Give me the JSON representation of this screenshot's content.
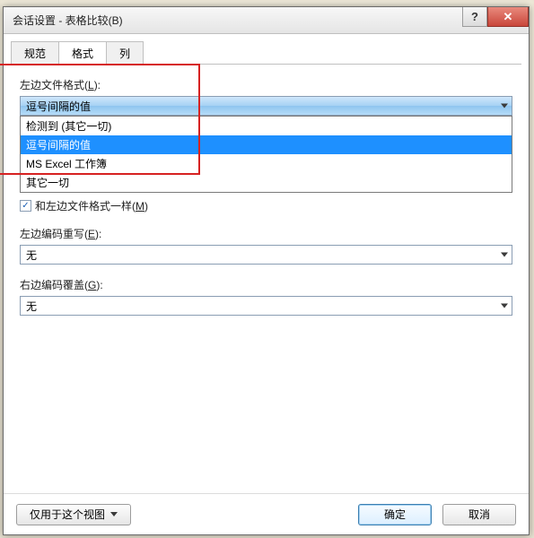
{
  "window": {
    "title": "会话设置 - 表格比较(B)",
    "help_glyph": "?",
    "close_glyph": "✕"
  },
  "tabs": [
    {
      "label": "规范",
      "active": false
    },
    {
      "label": "格式",
      "active": true
    },
    {
      "label": "列",
      "active": false
    }
  ],
  "left_format": {
    "label_prefix": "左边文件格式(",
    "label_mnemonic": "L",
    "label_suffix": "):",
    "combo_value": "逗号间隔的值",
    "options": [
      {
        "label": "检测到 (其它一切)",
        "selected": false
      },
      {
        "label": "逗号间隔的值",
        "selected": true
      },
      {
        "label": "MS Excel 工作簿",
        "selected": false
      },
      {
        "label": "其它一切",
        "selected": false
      }
    ]
  },
  "same_as_left": {
    "checked": true,
    "label_prefix": "和左边文件格式一样(",
    "label_mnemonic": "M",
    "label_suffix": ")"
  },
  "left_encoding_override": {
    "label_prefix": "左边编码重写(",
    "label_mnemonic": "E",
    "label_suffix": "):",
    "value": "无"
  },
  "right_encoding_override": {
    "label_prefix": "右边编码覆盖(",
    "label_mnemonic": "G",
    "label_suffix": "):",
    "value": "无"
  },
  "buttons": {
    "view_only": "仅用于这个视图",
    "ok": "确定",
    "cancel": "取消"
  }
}
